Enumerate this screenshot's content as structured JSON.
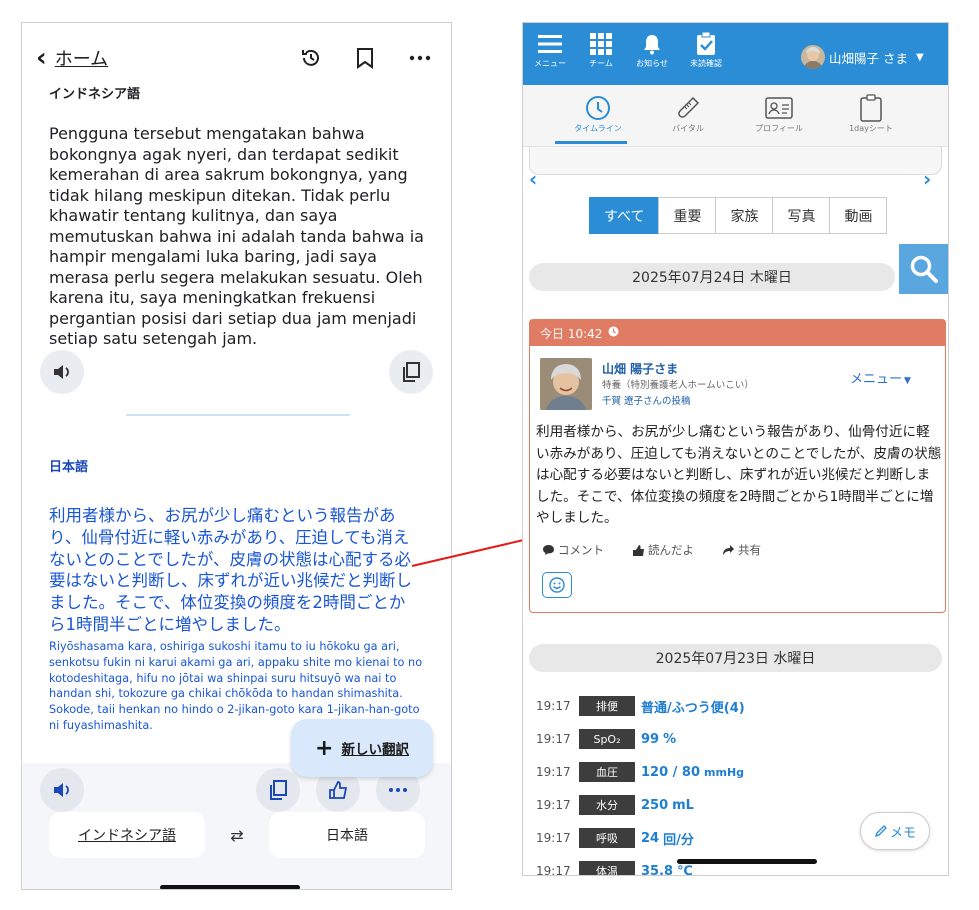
{
  "left": {
    "header": {
      "back_label": "ホーム"
    },
    "source": {
      "language_label": "インドネシア語",
      "text": "Pengguna tersebut mengatakan bahwa bokongnya agak nyeri, dan terdapat sedikit kemerahan di area sakrum bokongnya, yang tidak hilang meskipun ditekan. Tidak perlu khawatir tentang kulitnya, dan saya memutuskan bahwa ini adalah tanda bahwa ia hampir mengalami luka baring, jadi saya merasa perlu segera melakukan sesuatu. Oleh karena itu, saya meningkatkan frekuensi pergantian posisi dari setiap dua jam menjadi setiap satu setengah jam."
    },
    "target": {
      "language_label": "日本語",
      "text": "利用者様から、お尻が少し痛むという報告があり、仙骨付近に軽い赤みがあり、圧迫しても消えないとのことでしたが、皮膚の状態は心配する必要はないと判断し、床ずれが近い兆候だと判断しました。そこで、体位変換の頻度を2時間ごとから1時間半ごとに増やしました。",
      "romaji": "Riyōshasama kara, oshiriga sukoshi itamu to iu hōkoku ga ari, senkotsu fukin ni karui akami ga ari, appaku shite mo kienai to no kotodeshitaga, hifu no jōtai wa shinpai suru hitsuyō wa nai to handan shi, tokozure ga chikai chōkōda to handan shimashita. Sokode, taii henkan no hindo o 2-jikan-goto kara 1-jikan-han-goto ni fuyashimashita."
    },
    "new_translation_label": "新しい翻訳",
    "language_bar": {
      "from": "インドネシア語",
      "to": "日本語"
    }
  },
  "right": {
    "topnav": {
      "items": [
        {
          "label": "メニュー"
        },
        {
          "label": "チーム"
        },
        {
          "label": "お知らせ"
        },
        {
          "label": "未読確認"
        }
      ],
      "user_name": "山畑陽子 さま"
    },
    "subnav": {
      "items": [
        {
          "label": "タイムライン"
        },
        {
          "label": "バイタル"
        },
        {
          "label": "プロフィール"
        },
        {
          "label": "1dayシート"
        }
      ]
    },
    "filters": [
      "すべて",
      "重要",
      "家族",
      "写真",
      "動画"
    ],
    "date1": "2025年07月24日 木曜日",
    "post": {
      "time": "今日 10:42",
      "name": "山畑 陽子さま",
      "facility": "特養（特別養護老人ホームいこい）",
      "posted_by": "千賀 遼子さんの投稿",
      "menu_label": "メニュー",
      "body": "利用者様から、お尻が少し痛むという報告があり、仙骨付近に軽い赤みがあり、圧迫しても消えないとのことでしたが、皮膚の状態は心配する必要はないと判断し、床ずれが近い兆候だと判断しました。そこで、体位変換の頻度を2時間ごとから1時間半ごとに増やしました。",
      "comment_label": "コメント",
      "read_label": "読んだよ",
      "share_label": "共有"
    },
    "date2": "2025年07月23日 水曜日",
    "vitals": [
      {
        "time": "19:17",
        "tag": "排便",
        "value": "普通/ふつう便(4)",
        "unit": ""
      },
      {
        "time": "19:17",
        "tag": "SpO₂",
        "value": "99",
        "unit": "%"
      },
      {
        "time": "19:17",
        "tag": "血圧",
        "value": "120 / 80",
        "unit": "mmHg"
      },
      {
        "time": "19:17",
        "tag": "水分",
        "value": "250",
        "unit": "mL"
      },
      {
        "time": "19:17",
        "tag": "呼吸",
        "value": "24",
        "unit": "回/分"
      },
      {
        "time": "19:17",
        "tag": "体温",
        "value": "35.8",
        "unit": "℃"
      }
    ],
    "memo_label": "メモ"
  }
}
